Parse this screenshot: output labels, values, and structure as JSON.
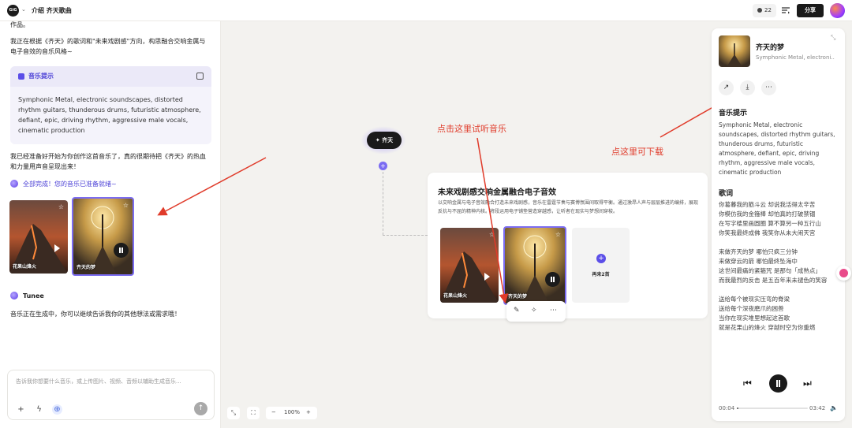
{
  "topbar": {
    "logo_text": "GiG",
    "title": "介绍 齐天歌曲",
    "credits": "22",
    "share_label": "分享"
  },
  "chat": {
    "intro_tail": "作品。",
    "intro_line": "我正在根据《齐天》的歌词和\"未来戏剧感\"方向，构思融合交响金属与电子音效的音乐风格~",
    "prompt_card": {
      "title": "音乐提示",
      "body": "Symphonic Metal, electronic soundscapes, distorted rhythm guitars, thunderous drums, futuristic atmosphere, defiant, epic, driving rhythm, aggressive male vocals, cinematic production"
    },
    "ready_line": "我已经准备好开始为你创作这首音乐了，真的很期待把《齐天》的热血和力量用声音呈现出来！",
    "done_line": "全部完成！您的音乐已准备就绪~",
    "songs": [
      {
        "title": "花果山烽火"
      },
      {
        "title": "齐天的梦"
      }
    ],
    "agent_name": "Tunee",
    "agent_msg": "音乐正在生成中，你可以继续告诉我你的其他想法或需求哦！",
    "input_placeholder": "告诉我你想要什么音乐，或上传图片、视频、音频以辅助生成音乐..."
  },
  "canvas": {
    "node_label": "✦ 齐天",
    "card": {
      "title": "未来戏剧感交响金属融合电子音效",
      "desc": "以交响金属与电子音效融合打造未来戏剧感，音乐在雷霆节奏与赛博氛围间取得平衡。通过激昂人声与层层推进的编排，展现反抗与不屈的精神内核。将段运用电子铺垫营造穿越感，让听者在现实与梦想间穿梭。",
      "songs": [
        {
          "title": "花果山烽火"
        },
        {
          "title": "齐天的梦"
        }
      ],
      "more_label": "再来2首"
    },
    "annotations": {
      "listen": "点击这里试听音乐",
      "download": "点这里可下载"
    },
    "zoom": "100%"
  },
  "detail": {
    "title": "齐天的梦",
    "subtitle": "Symphonic Metal, electroni...",
    "prompt_heading": "音乐提示",
    "prompt_text": "Symphonic Metal, electronic soundscapes, distorted rhythm guitars, thunderous drums, futuristic atmosphere, defiant, epic, driving rhythm, aggressive male vocals, cinematic production",
    "lyrics_heading": "歌词",
    "lyrics_block1": [
      "你葛暮我的筋斗云 却说我活得太辛苦",
      "你模仿我的金箍棒 却怕真的打破禁锢",
      "在写字楼里画圆圈 算不算另一种五行山",
      "你笑我最终成佛 我笑你从未大闹天宫"
    ],
    "lyrics_block2": [
      "来做齐天的梦 哪怕只疯三分钟",
      "来做穿云的箭 哪怕最终坠海中",
      "这世间最痛的紧箍咒 是那句「成熟点」",
      "而我最烈的反击 是五百年来未褪色的笑容"
    ],
    "lyrics_block3": [
      "送给每个被现实压弯的脊梁",
      "送给每个深夜磨爪的困兽",
      "当你在现实堆里想起这首歌",
      "就是花果山的烽火 穿越时空为你重燃"
    ],
    "time_current": "00:04",
    "time_total": "03:42",
    "progress": 0.02
  }
}
